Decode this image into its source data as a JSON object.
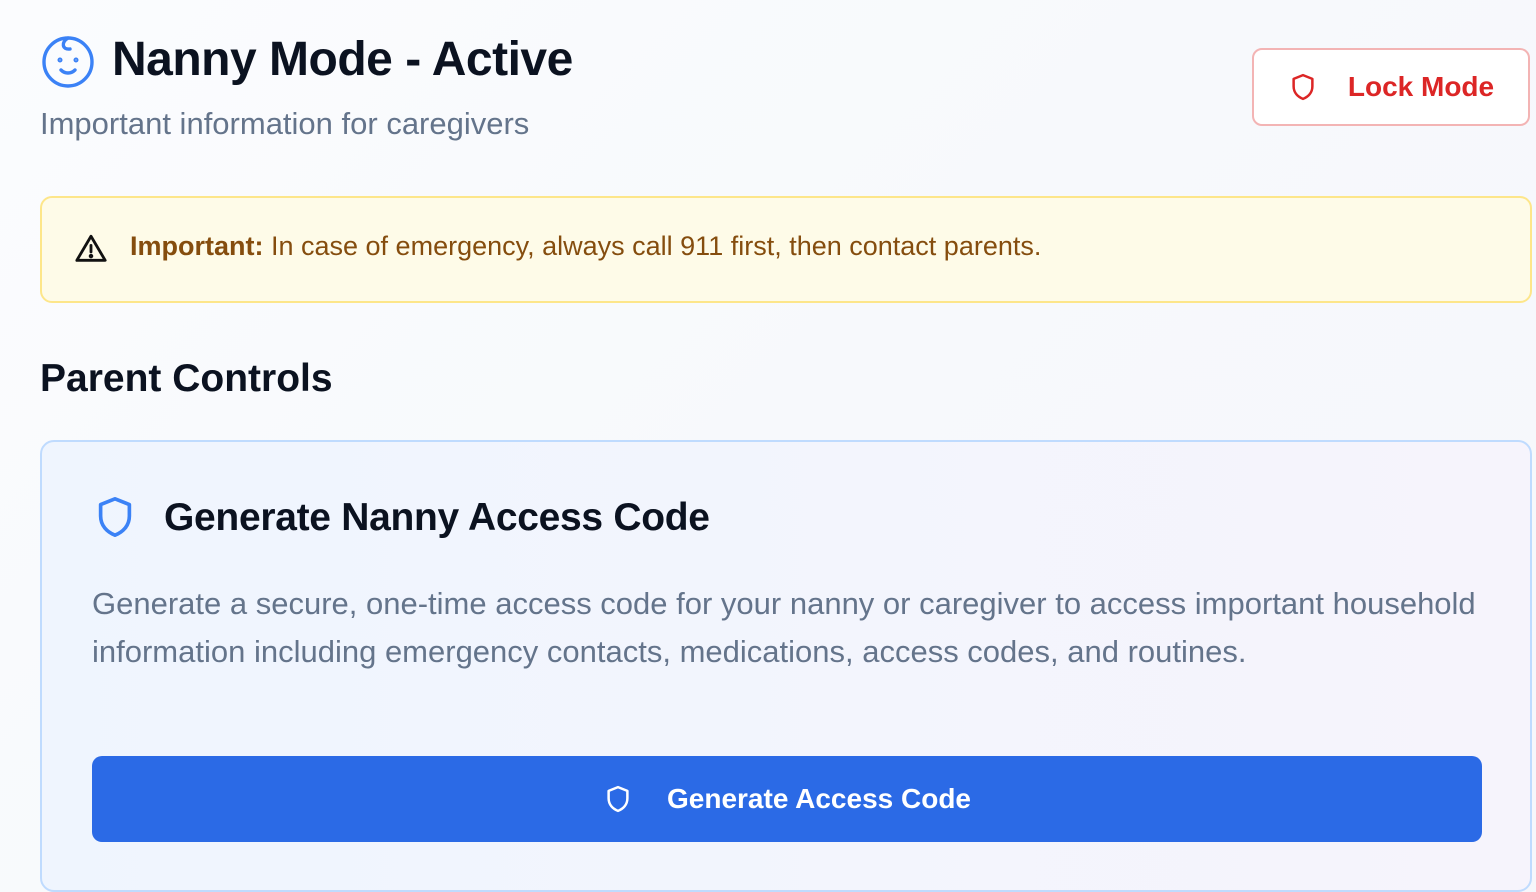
{
  "header": {
    "title": "Nanny Mode - Active",
    "subtitle": "Important information for caregivers",
    "icon": "baby-face-icon",
    "lock_button": {
      "label": "Lock Mode",
      "icon": "shield-icon"
    }
  },
  "alert": {
    "icon": "warning-triangle-icon",
    "strong": "Important:",
    "message": " In case of emergency, always call 911 first, then contact parents."
  },
  "parent_controls": {
    "heading": "Parent Controls",
    "card": {
      "icon": "shield-icon",
      "title": "Generate Nanny Access Code",
      "description": "Generate a secure, one-time access code for your nanny or caregiver to access important household information including emergency contacts, medications, access codes, and routines.",
      "button_label": "Generate Access Code",
      "button_icon": "shield-icon"
    }
  },
  "colors": {
    "accent_blue": "#2b6ae6",
    "danger_red": "#dc2626",
    "warning_text": "#854d0e",
    "warning_bg": "#fefbe8",
    "warning_border": "#fde68a",
    "card_border": "#bfdbfe",
    "muted_text": "#64748b",
    "heading_text": "#0b1220"
  }
}
